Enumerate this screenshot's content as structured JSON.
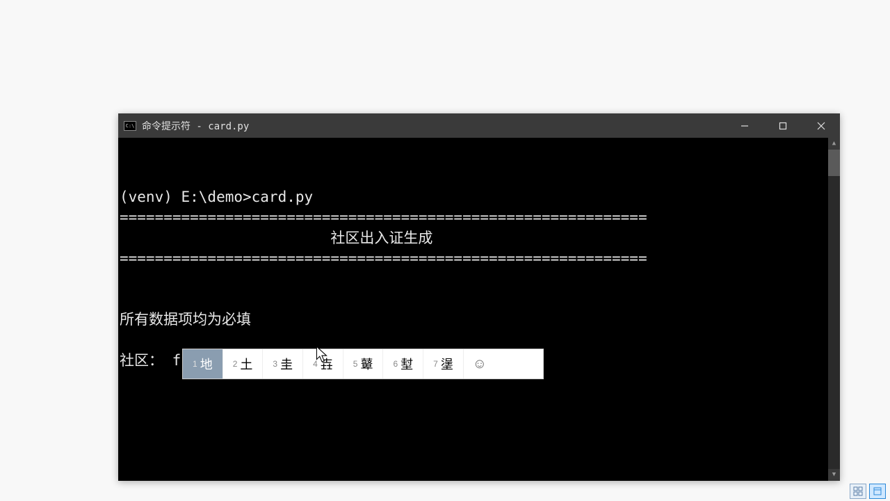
{
  "window": {
    "title": "命令提示符 - card.py",
    "icon_label": "C:\\"
  },
  "terminal": {
    "prompt_line": "(venv) E:\\demo>card.py",
    "divider": "============================================================",
    "title_centered": "                        社区出入证生成",
    "note": "所有数据项均为必填",
    "input_label": "社区：",
    "input_value": "f"
  },
  "ime": {
    "candidates": [
      {
        "n": "1",
        "char": "地",
        "selected": true
      },
      {
        "n": "2",
        "char": "土",
        "selected": false
      },
      {
        "n": "3",
        "char": "圭",
        "selected": false
      },
      {
        "n": "4",
        "char": "壵",
        "selected": false
      },
      {
        "n": "5",
        "char": "鼙",
        "selected": false
      },
      {
        "n": "6",
        "char": "堼",
        "selected": false
      },
      {
        "n": "7",
        "char": "塣",
        "selected": false
      }
    ],
    "emoji_icon": "☺"
  },
  "scrollbar": {
    "up": "▲",
    "down": "▼"
  },
  "taskbar": {
    "grid_icon": "⊞",
    "page_icon": "▭"
  }
}
